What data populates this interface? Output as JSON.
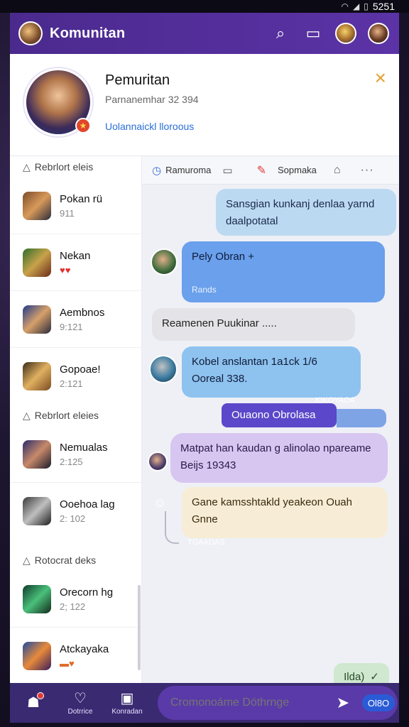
{
  "status": {
    "time": "5251"
  },
  "topbar": {
    "title": "Komunitan"
  },
  "profile": {
    "name": "Pemuritan",
    "subtitle": "Parnanemhar  32 394",
    "link": "Uolannaickl lloroous"
  },
  "sidebar": {
    "sections": [
      {
        "header": "Rebrlort eleis",
        "contacts": [
          {
            "name": "Pokan rü",
            "meta": "911"
          },
          {
            "name": "Nekan",
            "meta": ""
          },
          {
            "name": "Aembnos",
            "meta": "9:121"
          },
          {
            "name": "Gopoae!",
            "meta": "2:121"
          }
        ]
      },
      {
        "header": "Rebrlort eleies",
        "contacts": [
          {
            "name": "Nemualas",
            "meta": "2:125"
          },
          {
            "name": "Ooehoa lag",
            "meta": "2: 102"
          }
        ]
      },
      {
        "header": "Rotocrat deks",
        "contacts": [
          {
            "name": "Orecorn hg",
            "meta": "2; 122"
          },
          {
            "name": "Atckayaka",
            "meta": ""
          }
        ]
      }
    ]
  },
  "chat": {
    "header": {
      "left": "Ramuroma",
      "right": "Sopmaka"
    },
    "messages": [
      {
        "text": "Sansgian kunkanj denlaa yarnd daalpotatal"
      },
      {
        "text": "Pely Obran +",
        "meta": "Rands"
      },
      {
        "text": "Reamenen  Puukinar  ....."
      },
      {
        "text": "Kobel anslantan  1a1ck  1/6 Ooreal 338.",
        "meta": "KIKOYAOA"
      },
      {
        "text": "Ouaono Obrolasa"
      },
      {
        "text": "Matpat  han kaudan g alinolao npareame Beijs  19343"
      },
      {
        "text": "Gane kamsshtakld yeakeon  Ouah Gnne",
        "meta": "TGAADAS"
      }
    ],
    "read_pill": "Ilda)"
  },
  "bottom": {
    "nav": [
      {
        "label": ""
      },
      {
        "label": "Dotrrice"
      },
      {
        "label": "Konradan"
      }
    ],
    "composer_placeholder": "Cromonoáme Döthrnge",
    "cta": "Ol8O"
  },
  "colors": {
    "brand": "#4b2a8e",
    "outgoing": "#6aa0ec",
    "incoming": "#e4e4e8",
    "accent": "#5b47c9"
  }
}
